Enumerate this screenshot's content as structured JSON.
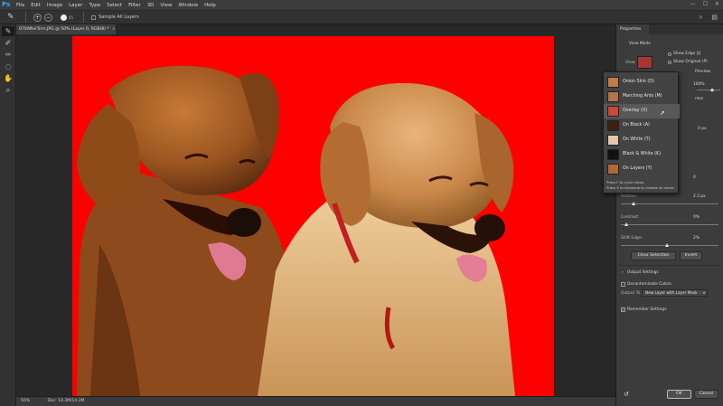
{
  "app": {
    "logo": "Ps",
    "menu": [
      "File",
      "Edit",
      "Image",
      "Layer",
      "Type",
      "Select",
      "Filter",
      "3D",
      "View",
      "Window",
      "Help"
    ],
    "window_controls": [
      "—",
      "☐",
      "✕"
    ]
  },
  "options_bar": {
    "brush_size": "45",
    "sample_all_layers": "Sample All Layers",
    "right_icons": [
      "search-icon",
      "workspace-icon"
    ]
  },
  "tools": [
    "quick-selection-tool-icon",
    "refine-radius-tool-icon",
    "brush-tool-icon",
    "lasso-tool-icon",
    "hand-tool-icon",
    "zoom-tool-icon"
  ],
  "document": {
    "tab_title": "070AfterTrim.JPG @ 50% (Layer 0, RGB/8) *",
    "background_color": "#ff0000"
  },
  "status": {
    "zoom": "50%",
    "doc_size": "Doc: 14.3M/14.3M"
  },
  "properties": {
    "tab_label": "Properties",
    "view_mode_header": "View Mode",
    "view_label": "View:",
    "show_edge": "Show Edge (J)",
    "show_original": "Show Original (P)",
    "preview": "Preview",
    "transparency_value": "100%",
    "radius_value": "0 px",
    "smooth_value": "0",
    "feather_label": "Feather:",
    "feather_value": "2.2 px",
    "contrast_label": "Contrast:",
    "contrast_value": "0%",
    "shift_edge_label": "Shift Edge:",
    "shift_edge_value": "2%",
    "clear_selection": "Clear Selection",
    "invert": "Invert",
    "output_settings": "Output Settings",
    "decontaminate": "Decontaminate Colors",
    "output_to_label": "Output To:",
    "output_to_value": "New Layer with Layer Mask",
    "remember_settings": "Remember Settings",
    "ok": "OK",
    "cancel": "Cancel"
  },
  "view_dropdown": {
    "items": [
      {
        "label": "Onion Skin (O)"
      },
      {
        "label": "Marching Ants (M)"
      },
      {
        "label": "Overlay (V)",
        "selected": true
      },
      {
        "label": "On Black (A)"
      },
      {
        "label": "On White (T)"
      },
      {
        "label": "Black & White (K)"
      },
      {
        "label": "On Layers (Y)"
      }
    ],
    "hint_1": "Press F to cycle views.",
    "hint_2": "Press X to temporarily disable all views."
  }
}
